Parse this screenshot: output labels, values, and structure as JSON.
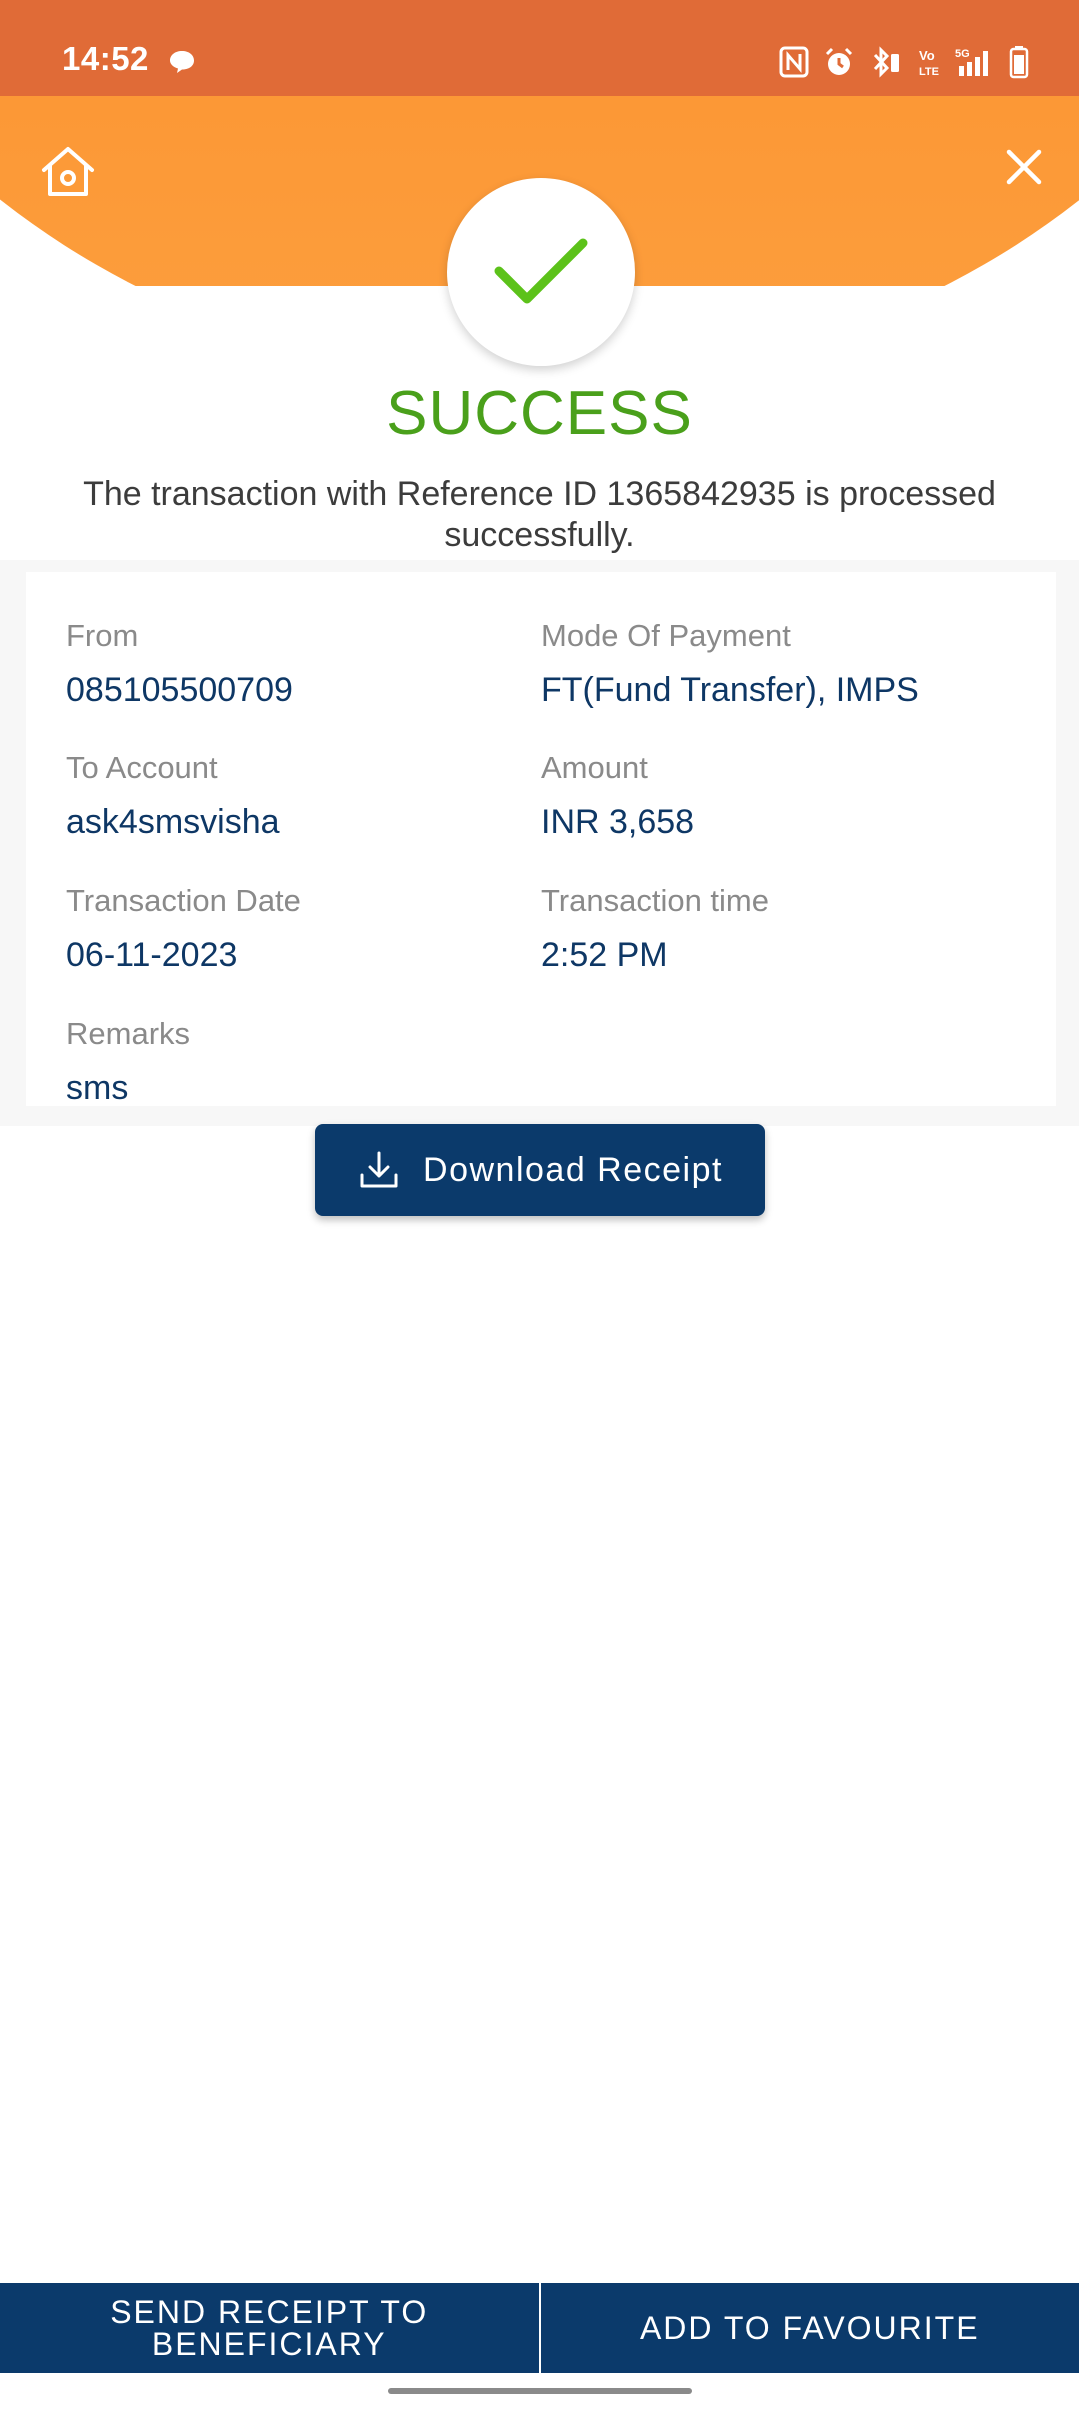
{
  "status_bar": {
    "time": "14:52",
    "icons": [
      "chat-bubble-icon",
      "nfc-icon",
      "alarm-icon",
      "bluetooth-icon",
      "volte-icon",
      "signal-5g-icon",
      "battery-icon"
    ]
  },
  "header": {
    "home_icon": "home-icon",
    "close_icon": "close-icon",
    "check_icon": "checkmark-icon"
  },
  "result": {
    "title": "SUCCESS",
    "message": "The transaction with Reference ID 1365842935 is processed successfully."
  },
  "details": {
    "from_label": "From",
    "from_value": "085105500709",
    "mode_label": "Mode Of Payment",
    "mode_value": "FT(Fund Transfer), IMPS",
    "to_label": "To Account",
    "to_value": "ask4smsvisha",
    "amount_label": "Amount",
    "amount_value": "INR 3,658",
    "date_label": "Transaction Date",
    "date_value": "06-11-2023",
    "time_label": "Transaction time",
    "time_value": "2:52 PM",
    "remarks_label": "Remarks",
    "remarks_value": "sms"
  },
  "download": {
    "label": "Download Receipt",
    "icon": "download-icon"
  },
  "bottom_actions": {
    "send_line1": "SEND RECEIPT TO",
    "send_line2": "BENEFICIARY",
    "favourite": "ADD TO FAVOURITE"
  },
  "colors": {
    "status_bar": "#e06b37",
    "header_orange": "#f77a12",
    "success_green": "#4aa01b",
    "navy": "#0b3a6b",
    "value_text": "#0e3765"
  }
}
